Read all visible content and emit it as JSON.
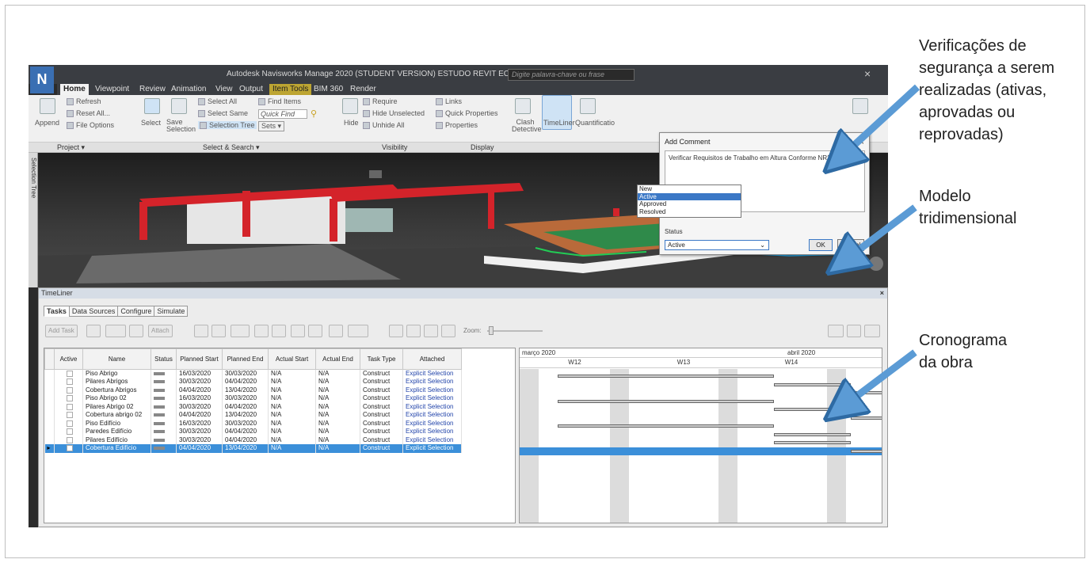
{
  "app": {
    "logo": "N",
    "title": "Autodesk Navisworks Manage 2020 (STUDENT VERSION)   ESTUDO REVIT ECB.rvt",
    "search_placeholder": "Digite palavra-chave ou frase",
    "close_glyph": "×",
    "tabs": [
      "Home",
      "Viewpoint",
      "Review",
      "Animation",
      "View",
      "Output",
      "Item Tools",
      "BIM 360",
      "Render"
    ]
  },
  "ribbon": {
    "append": "Append",
    "refresh": "Refresh",
    "reset_all": "Reset All...",
    "file_options": "File Options",
    "select": "Select",
    "save_selection": "Save Selection",
    "select_all": "Select All",
    "select_same": "Select Same",
    "selection_tree": "Selection Tree",
    "find_items": "Find Items",
    "quick_find": "Quick Find",
    "sets": "Sets",
    "hide": "Hide",
    "require": "Require",
    "hide_unselected": "Hide Unselected",
    "unhide_all": "Unhide All",
    "links": "Links",
    "quick_properties": "Quick Properties",
    "properties": "Properties",
    "clash_detective": "Clash Detective",
    "timeliner": "TimeLiner",
    "quantification": "Quantificatio",
    "group_project": "Project ▾",
    "group_select_search": "Select & Search ▾",
    "group_visibility": "Visibility",
    "group_display": "Display"
  },
  "side_tab": "Selection Tree",
  "timeliner": {
    "title": "TimeLiner",
    "tabs": [
      "Tasks",
      "Data Sources",
      "Configure",
      "Simulate"
    ],
    "toolbar": {
      "add_task": "Add Task",
      "attach": "Attach",
      "zoom": "Zoom:"
    },
    "columns": [
      "Active",
      "Name",
      "Status",
      "Planned Start",
      "Planned End",
      "Actual Start",
      "Actual End",
      "Task Type",
      "Attached"
    ],
    "rows": [
      {
        "name": "Piso Abrigo",
        "planned_start": "16/03/2020",
        "planned_end": "30/03/2020",
        "actual_start": "N/A",
        "actual_end": "N/A",
        "type": "Construct",
        "attached": "Explicit Selection"
      },
      {
        "name": "Pilares Abrigos",
        "planned_start": "30/03/2020",
        "planned_end": "04/04/2020",
        "actual_start": "N/A",
        "actual_end": "N/A",
        "type": "Construct",
        "attached": "Explicit Selection"
      },
      {
        "name": "Cobertura Abrigos",
        "planned_start": "04/04/2020",
        "planned_end": "13/04/2020",
        "actual_start": "N/A",
        "actual_end": "N/A",
        "type": "Construct",
        "attached": "Explicit Selection"
      },
      {
        "name": "Piso Abrigo 02",
        "planned_start": "16/03/2020",
        "planned_end": "30/03/2020",
        "actual_start": "N/A",
        "actual_end": "N/A",
        "type": "Construct",
        "attached": "Explicit Selection"
      },
      {
        "name": "Pilares Abrigo 02",
        "planned_start": "30/03/2020",
        "planned_end": "04/04/2020",
        "actual_start": "N/A",
        "actual_end": "N/A",
        "type": "Construct",
        "attached": "Explicit Selection"
      },
      {
        "name": "Cobertura abrigo 02",
        "planned_start": "04/04/2020",
        "planned_end": "13/04/2020",
        "actual_start": "N/A",
        "actual_end": "N/A",
        "type": "Construct",
        "attached": "Explicit Selection"
      },
      {
        "name": "Piso Edifício",
        "planned_start": "16/03/2020",
        "planned_end": "30/03/2020",
        "actual_start": "N/A",
        "actual_end": "N/A",
        "type": "Construct",
        "attached": "Explicit Selection"
      },
      {
        "name": "Paredes Edifício",
        "planned_start": "30/03/2020",
        "planned_end": "04/04/2020",
        "actual_start": "N/A",
        "actual_end": "N/A",
        "type": "Construct",
        "attached": "Explicit Selection"
      },
      {
        "name": "Pilares Edifício",
        "planned_start": "30/03/2020",
        "planned_end": "04/04/2020",
        "actual_start": "N/A",
        "actual_end": "N/A",
        "type": "Construct",
        "attached": "Explicit Selection"
      },
      {
        "name": "Cobertura Edifício",
        "planned_start": "04/04/2020",
        "planned_end": "13/04/2020",
        "actual_start": "N/A",
        "actual_end": "N/A",
        "type": "Construct",
        "attached": "Explicit Selection",
        "selected": true
      }
    ],
    "gantt": {
      "month1": "março 2020",
      "month2": "abril 2020",
      "weeks": [
        "W12",
        "W13",
        "W14"
      ]
    }
  },
  "dialog": {
    "title": "Add Comment",
    "comment": "Verificar Requisitos de Trabalho em Altura Conforme NR35",
    "status_label": "Status",
    "status_value": "Active",
    "options": [
      "New",
      "Active",
      "Approved",
      "Resolved"
    ],
    "selected_option": "Active",
    "ok": "OK",
    "cancel": "Cancel"
  },
  "annotations": {
    "a1": [
      "Verificações de",
      "segurança a serem",
      "realizadas (ativas,",
      "aprovadas ou",
      "reprovadas)"
    ],
    "a2": [
      "Modelo",
      "tridimensional"
    ],
    "a3": [
      "Cronograma",
      "da obra"
    ]
  },
  "colors": {
    "accent": "#3b78c6",
    "arrow": "#5b9bd5",
    "selection_row": "#3b8fd9",
    "model_red": "#d4232a"
  }
}
